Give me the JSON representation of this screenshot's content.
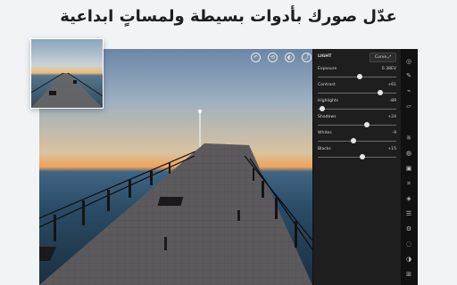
{
  "headline": "عدّل صورك بأدوات بسيطة ولمساتٍ ابداعية",
  "panel": {
    "title": "LIGHT",
    "curve_label": "Curve",
    "sliders": [
      {
        "label": "Exposure",
        "value": "0.38EV",
        "level": 0.53
      },
      {
        "label": "Contrast",
        "value": "+61",
        "level": 0.8
      },
      {
        "label": "Highlights",
        "value": "-89",
        "level": 0.06
      },
      {
        "label": "Shadows",
        "value": "+24",
        "level": 0.63
      },
      {
        "label": "Whites",
        "value": "-9",
        "level": 0.46
      },
      {
        "label": "Blacks",
        "value": "+15",
        "level": 0.57
      }
    ]
  },
  "top_icons": [
    "undo-icon",
    "history-icon",
    "profile-icon",
    "share-icon",
    "more-icon"
  ],
  "rail_icons": [
    "presets-icon",
    "brush-icon",
    "healing-icon",
    "eraser-icon",
    "light-icon",
    "color-icon",
    "vignette-icon",
    "crop-icon",
    "selective-icon",
    "layers-icon",
    "settings-icon",
    "details-icon",
    "optics-icon",
    "geometry-icon"
  ],
  "colors": {
    "panel": "#1e1e1e",
    "rail": "#111111",
    "background": "#f2f3f5"
  }
}
